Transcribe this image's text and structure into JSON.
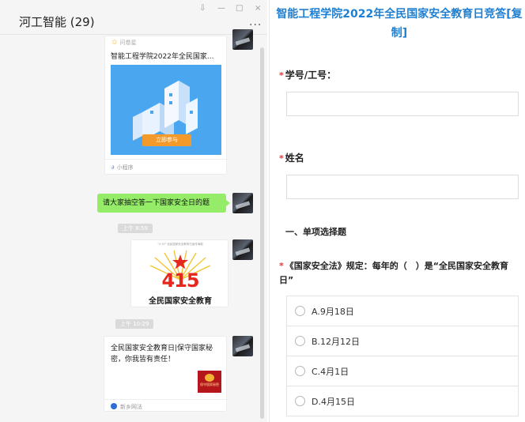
{
  "chat": {
    "title": "河工智能 (29)",
    "window_controls": {
      "pin": "⇩",
      "minimize": "—",
      "maximize": "□",
      "close": "×"
    },
    "more_label": "···",
    "mini_program_card": {
      "source": "问卷星",
      "title": "智能工程学院2022年全民国家...",
      "button_label": "立即参与",
      "footer": "小程序"
    },
    "text_message": "请大家抽空答一下国家安全日的题",
    "time_1": "上午 8:59",
    "image_message": {
      "top_text": "\"4·15\" 全民国家安全教育日宣传海报",
      "number": "415",
      "caption": "全民国家安全教育"
    },
    "time_2": "上午 10:29",
    "article_card": {
      "text": "全民国家安全教育日|保守国家秘密，你我皆有责任！",
      "thumb_text": "保守国家秘密",
      "footer": "新乡网法"
    }
  },
  "form": {
    "title": "智能工程学院2022年全民国家安全教育日竞答[复制]",
    "required_mark": "*",
    "field_id_label": "学号/工号：",
    "field_id_value": "",
    "field_name_label": "姓名",
    "field_name_value": "",
    "section_title": "一、单项选择题",
    "question_1": "《国家安全法》规定：每年的（　）是“全民国家安全教育日”",
    "options": [
      "A.9月18日",
      "B.12月12日",
      "C.4月1日",
      "D.4月15日"
    ]
  },
  "colors": {
    "form_title": "#1f7fd1",
    "required": "#e33333",
    "chat_bubble": "#95ec69",
    "mini_program_button": "#f39a2b"
  }
}
